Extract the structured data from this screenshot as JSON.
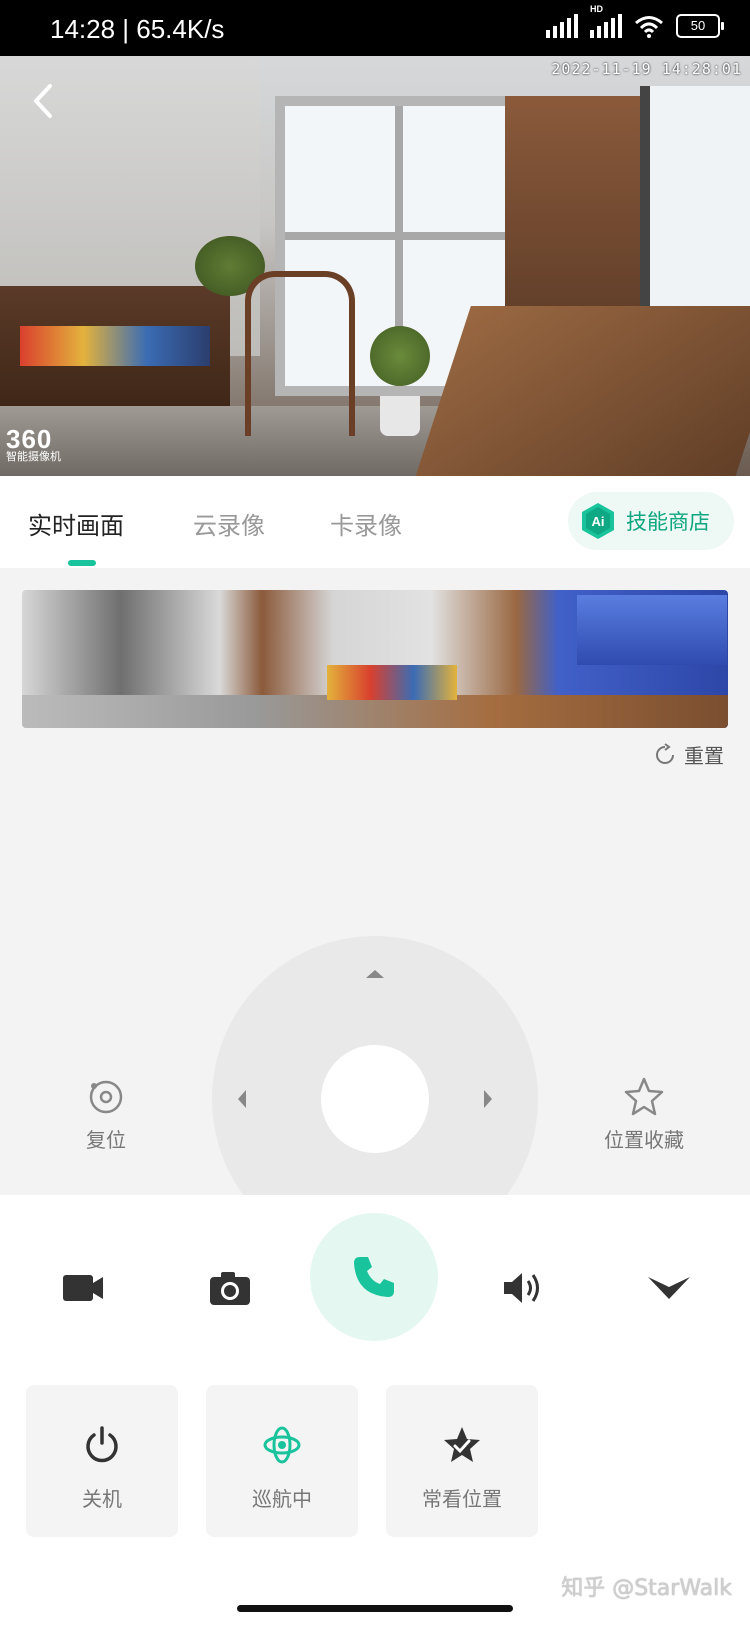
{
  "status_bar": {
    "time": "14:28 | 65.4K/s",
    "hd": "HD",
    "battery": "50"
  },
  "video": {
    "timestamp": "2022-11-19  14:28:01",
    "brand_main": "360",
    "brand_sub": "智能摄像机"
  },
  "tabs": [
    {
      "label": "实时画面",
      "active": true
    },
    {
      "label": "云录像",
      "active": false
    },
    {
      "label": "卡录像",
      "active": false
    }
  ],
  "skill_store": {
    "icon_text": "Ai",
    "label": "技能商店"
  },
  "panorama": {
    "reset_label": "重置"
  },
  "ptz": {
    "home_label": "复位",
    "favorite_label": "位置收藏"
  },
  "toolbar": [
    {
      "icon": "video-camera-icon"
    },
    {
      "icon": "camera-icon"
    },
    {
      "icon": "phone-icon"
    },
    {
      "icon": "speaker-icon"
    },
    {
      "icon": "chevron-down-icon"
    }
  ],
  "cards": [
    {
      "icon": "power-icon",
      "label": "关机"
    },
    {
      "icon": "cruise-icon",
      "label": "巡航中"
    },
    {
      "icon": "star-badge-icon",
      "label": "常看位置"
    }
  ],
  "watermark": "知乎 @StarWalk",
  "colors": {
    "accent": "#19c39b",
    "accent_light": "#e4f7f1",
    "page_bg": "#f3f3f3"
  }
}
